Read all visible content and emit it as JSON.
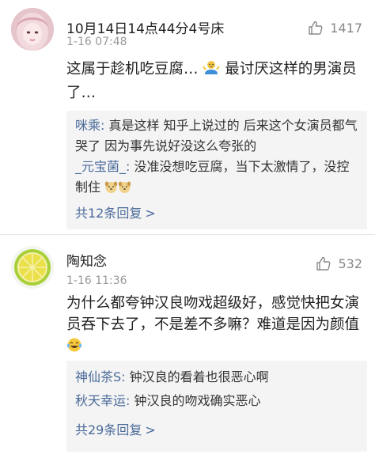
{
  "comments": [
    {
      "username": "10月14日14点44分4号床",
      "time": "1-16 07:48",
      "likes": "1417",
      "text": "这属于趁机吃豆腐…",
      "text_rest": "最讨厌这样的男演员了…",
      "replies": [
        {
          "user": "咪乘:",
          "text": " 真是这样  知乎上说过的  后来这个女演员都气哭了  因为事先说好没这么夸张的"
        },
        {
          "user": "_元宝菌_:",
          "text": " 没准没想吃豆腐，当下太激情了，没控制住"
        }
      ],
      "more_replies": "共12条回复",
      "more_arrow": ">"
    },
    {
      "username": "陶知念",
      "time": "1-16 11:36",
      "likes": "532",
      "text": "为什么都夸钟汉良吻戏超级好，感觉快把女演员吞下去了，不是差不多嘛？难道是因为颜值",
      "replies": [
        {
          "user": "神仙茶S:",
          "text": " 钟汉良的看着也很恶心啊"
        },
        {
          "user": "秋天幸运:",
          "text": " 钟汉良的吻戏确实恶心"
        }
      ],
      "more_replies": "共29条回复",
      "more_arrow": ">"
    }
  ],
  "colors": {
    "link": "#4a6a9a",
    "muted": "#999999",
    "reply_bg": "#f4f4f4"
  },
  "icons": {
    "like": "thumb-up-icon",
    "emoji_shrug": "shrug-emoji",
    "emoji_dog": "dog-face-emoji",
    "emoji_laugh": "tears-of-joy-emoji",
    "avatar_1": "girl-portrait-avatar",
    "avatar_2": "lemon-slice-avatar"
  }
}
